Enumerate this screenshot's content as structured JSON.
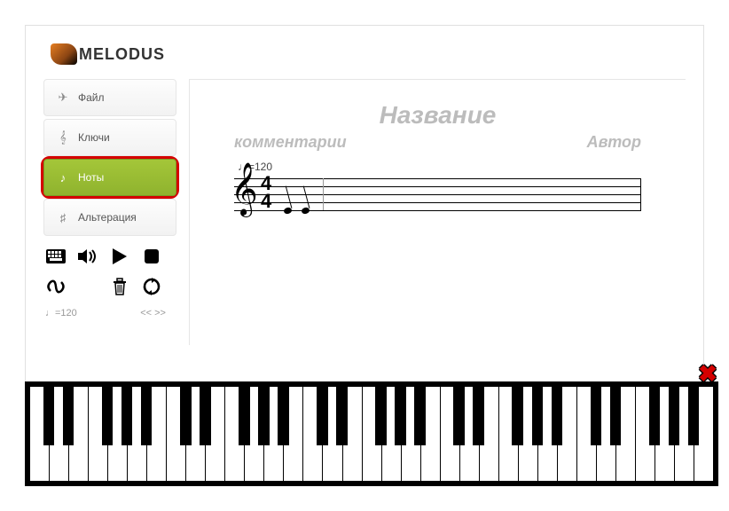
{
  "brand": "MELODUS",
  "sidebar": {
    "items": [
      {
        "label": "Файл",
        "icon": "✈"
      },
      {
        "label": "Ключи",
        "icon": "𝄞"
      },
      {
        "label": "Ноты",
        "icon": "♪",
        "active": true
      },
      {
        "label": "Альтерация",
        "icon": "♯"
      }
    ]
  },
  "toolbar": {
    "keyboard": "⌨",
    "sound": "🔊",
    "play": "▶",
    "stop": "■",
    "loop": "➰",
    "trash": "🗑",
    "refresh": "↻",
    "tempo_label": "♩=120",
    "nav": "<< >>"
  },
  "score": {
    "title": "Название",
    "comments": "комментарии",
    "author": "Автор",
    "tempo": "♩=120",
    "time_signature": {
      "top": "4",
      "bottom": "4"
    }
  },
  "piano": {
    "close": "✖",
    "white_keys": 35,
    "octave_pattern": [
      true,
      true,
      false,
      true,
      true,
      true,
      false
    ]
  }
}
